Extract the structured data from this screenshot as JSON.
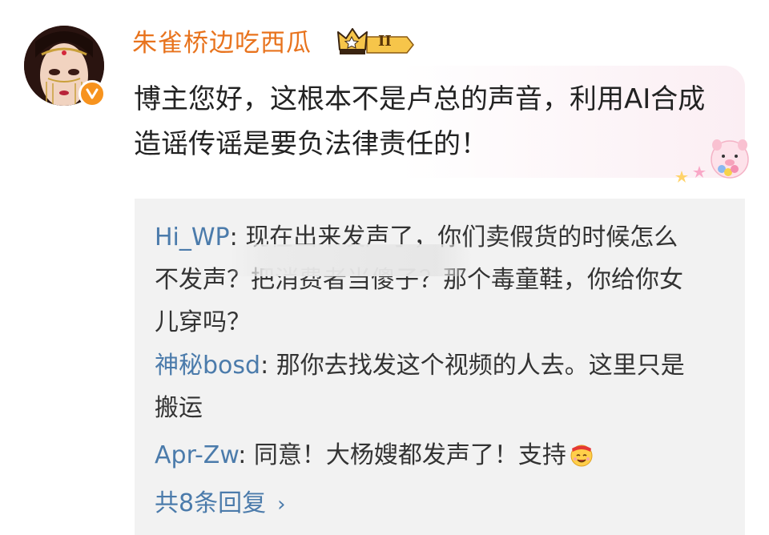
{
  "comment": {
    "username": "朱雀桥边吃西瓜",
    "rank_label": "II",
    "text": "博主您好，这根本不是卢总的声音，利用AI合成造谣传谣是要负法律责任的！"
  },
  "replies": [
    {
      "author": "Hi_WP",
      "separator": ": ",
      "text": "现在出来发声了，你们卖假货的时候怎么不发声？把消费者当傻子？那个毒童鞋，你给你女儿穿吗？"
    },
    {
      "author": "神秘bosd",
      "separator": ": ",
      "text": "那你去找发这个视频的人去。这里只是搬运"
    },
    {
      "author": "Apr-Zw",
      "separator": ": ",
      "text": "同意！大杨嫂都发声了！支持"
    }
  ],
  "view_more": {
    "label": "共8条回复",
    "chevron": "›"
  },
  "icons": {
    "verify": "verified-v-icon",
    "rank": "crown-rank-icon",
    "emoji": "cheering-emoji-icon",
    "decor": "pig-sticker-icon"
  },
  "colors": {
    "username": "#e8731d",
    "link": "#4b7bab",
    "reply_bg": "#f2f2f2",
    "bubble_tint": "#fbeef3",
    "verify": "#f7931e"
  }
}
